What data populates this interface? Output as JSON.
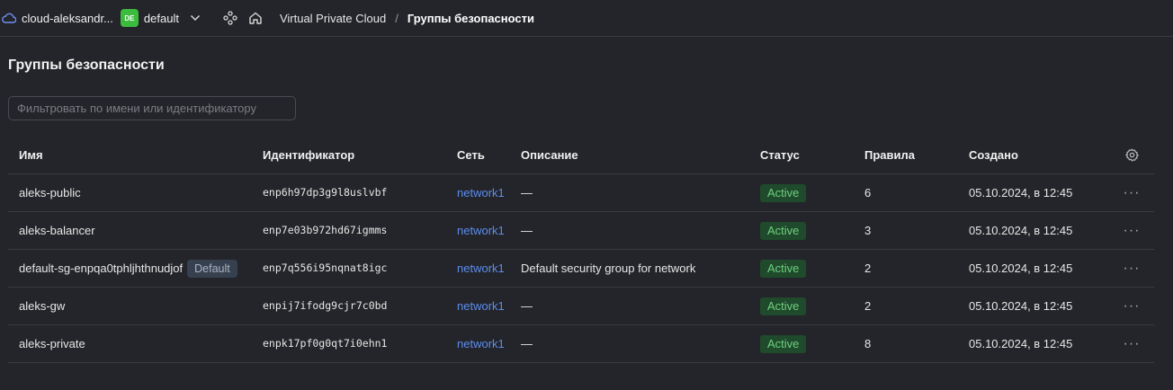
{
  "header": {
    "cloud_name": "cloud-aleksandr...",
    "folder_badge": "DE",
    "folder_name": "default",
    "breadcrumb": [
      {
        "label": "Virtual Private Cloud"
      },
      {
        "label": "Группы безопасности"
      }
    ],
    "breadcrumb_sep": "/"
  },
  "page": {
    "title": "Группы безопасности",
    "filter_placeholder": "Фильтровать по имени или идентификатору"
  },
  "table": {
    "columns": [
      "Имя",
      "Идентификатор",
      "Сеть",
      "Описание",
      "Статус",
      "Правила",
      "Создано"
    ],
    "rows": [
      {
        "name": "aleks-public",
        "tag": "",
        "id": "enp6h97dp3g9l8uslvbf",
        "network": "network1",
        "description": "—",
        "status": "Active",
        "rules": "6",
        "created": "05.10.2024, в 12:45"
      },
      {
        "name": "aleks-balancer",
        "tag": "",
        "id": "enp7e03b972hd67igmms",
        "network": "network1",
        "description": "—",
        "status": "Active",
        "rules": "3",
        "created": "05.10.2024, в 12:45"
      },
      {
        "name": "default-sg-enpqa0tphljhthnudjof",
        "tag": "Default",
        "id": "enp7q556i95nqnat8igc",
        "network": "network1",
        "description": "Default security group for network",
        "status": "Active",
        "rules": "2",
        "created": "05.10.2024, в 12:45"
      },
      {
        "name": "aleks-gw",
        "tag": "",
        "id": "enpij7ifodg9cjr7c0bd",
        "network": "network1",
        "description": "—",
        "status": "Active",
        "rules": "2",
        "created": "05.10.2024, в 12:45"
      },
      {
        "name": "aleks-private",
        "tag": "",
        "id": "enpk17pf0g0qt7i0ehn1",
        "network": "network1",
        "description": "—",
        "status": "Active",
        "rules": "8",
        "created": "05.10.2024, в 12:45"
      }
    ],
    "row_action": "···"
  },
  "colors": {
    "background": "#24252a",
    "accent_link": "#5b8def",
    "status_active_bg": "#1f4a2c",
    "status_active_fg": "#6fd07d",
    "folder_badge": "#3dbb3f"
  },
  "icons": [
    "cloud-icon",
    "chevron-down-icon",
    "services-icon",
    "home-icon",
    "gear-icon",
    "more-icon"
  ]
}
